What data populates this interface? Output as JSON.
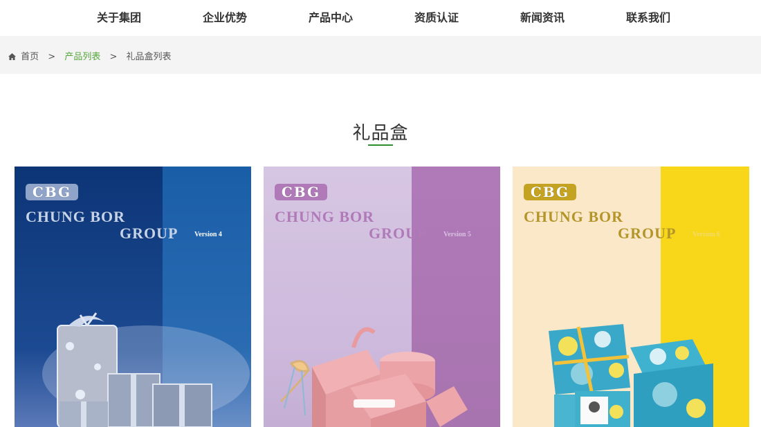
{
  "nav": {
    "items": [
      {
        "label": "关于集团"
      },
      {
        "label": "企业优势"
      },
      {
        "label": "产品中心"
      },
      {
        "label": "资质认证"
      },
      {
        "label": "新闻资讯"
      },
      {
        "label": "联系我们"
      }
    ]
  },
  "breadcrumb": {
    "home": "首页",
    "separator": ">",
    "items": [
      "产品列表",
      "礼品盒列表"
    ]
  },
  "section": {
    "title": "礼品盒"
  },
  "products": [
    {
      "logo": "CBG",
      "brand_line1": "CHUNG BOR",
      "brand_line2": "GROUP",
      "version": "Version 4",
      "colors": {
        "left": "#0e3a7e",
        "right": "#1a5ea8",
        "text": "#c7d3e6",
        "logo_bg": "#8fa4c8"
      }
    },
    {
      "logo": "CBG",
      "brand_line1": "CHUNG BOR",
      "brand_line2": "GROUP",
      "version": "Version 5",
      "colors": {
        "left": "#d6c4e2",
        "right": "#b07ab8",
        "text": "#b07ab8",
        "logo_bg": "#b07ab8"
      }
    },
    {
      "logo": "CBG",
      "brand_line1": "CHUNG BOR",
      "brand_line2": "GROUP",
      "version": "Version 6",
      "colors": {
        "left": "#fbe8c8",
        "right": "#f6d21a",
        "text": "#b3952a",
        "logo_bg": "#c4a323"
      }
    }
  ]
}
